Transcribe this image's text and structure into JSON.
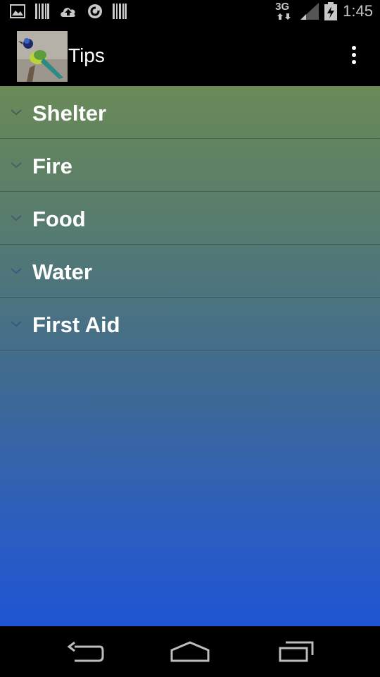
{
  "status_bar": {
    "time": "1:45",
    "network_label": "3G",
    "left_icons": [
      "image-icon",
      "barcode-icon",
      "cloud-upload-icon",
      "sync-icon",
      "barcode-icon"
    ],
    "right_icons": [
      "network-3g-icon",
      "signal-icon",
      "battery-charging-icon"
    ]
  },
  "action_bar": {
    "title": "Tips",
    "app_icon": "bird-app-icon",
    "overflow_icon": "overflow-menu-icon"
  },
  "tips": {
    "items": [
      {
        "label": "Shelter",
        "icon": "chevron-down-icon"
      },
      {
        "label": "Fire",
        "icon": "chevron-down-icon"
      },
      {
        "label": "Food",
        "icon": "chevron-down-icon"
      },
      {
        "label": "Water",
        "icon": "chevron-down-icon"
      },
      {
        "label": "First Aid",
        "icon": "chevron-down-icon"
      }
    ]
  },
  "nav_bar": {
    "icons": [
      "back-icon",
      "home-icon",
      "recents-icon"
    ]
  },
  "colors": {
    "gradient_top": "#6a8a57",
    "gradient_bottom": "#1f55d3",
    "bar_background": "#000000",
    "text": "#ffffff"
  }
}
